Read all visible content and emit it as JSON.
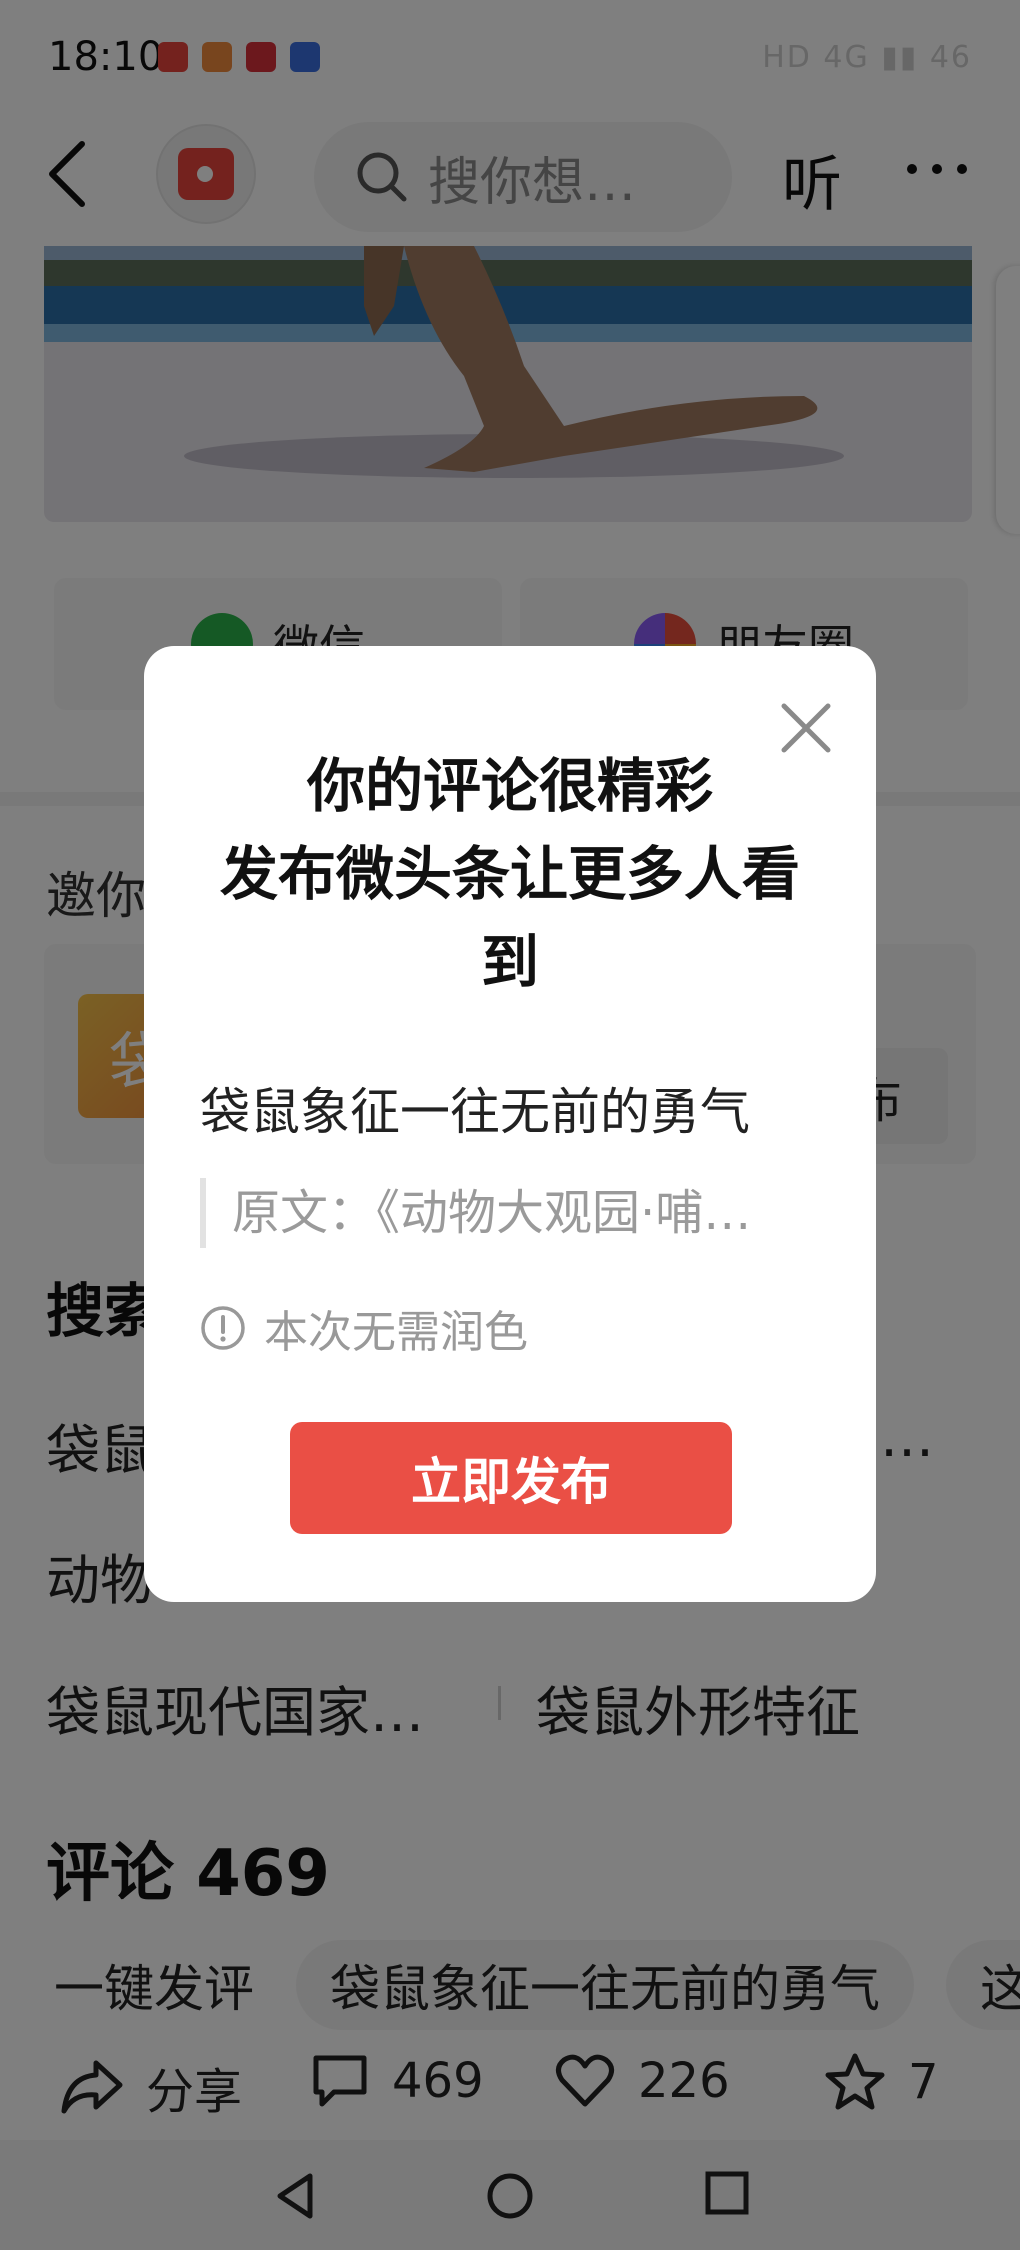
{
  "status_bar": {
    "time": "18:10",
    "right_indicators": "HD 4G ▮▮ 46"
  },
  "top_nav": {
    "search_placeholder": "搜你想…",
    "listen_label": "听"
  },
  "share_options": [
    {
      "label": "微信",
      "icon": "wechat-icon"
    },
    {
      "label": "朋友圈",
      "icon": "moments-icon"
    }
  ],
  "invite": {
    "title_partial": "邀你",
    "thumb_char": "袋",
    "publish_partial": "布"
  },
  "related_search": {
    "title_partial": "搜索",
    "items": [
      {
        "text": "袋鼠"
      },
      {
        "text": "…"
      },
      {
        "text": "动物"
      },
      {
        "text": "袋鼠现代国家…"
      },
      {
        "text": "袋鼠外形特征"
      }
    ]
  },
  "comments": {
    "title": "评论 469",
    "chips": [
      "一键发评",
      "袋鼠象征一往无前的勇气",
      "这"
    ]
  },
  "bottom_actions": {
    "share_label": "分享",
    "comment_count": "469",
    "like_count": "226",
    "favorite_count": "7"
  },
  "dialog": {
    "title_lines": [
      "你的评论很精彩",
      "发布微头条让更多人看",
      "到"
    ],
    "comment_text": "袋鼠象征一往无前的勇气",
    "quote_text": "原文：《动物大观园·哺…",
    "note_text": "本次无需润色",
    "publish_label": "立即发布"
  },
  "colors": {
    "accent": "#ea4f45",
    "overlay": "rgba(0,0,0,0.5)"
  }
}
